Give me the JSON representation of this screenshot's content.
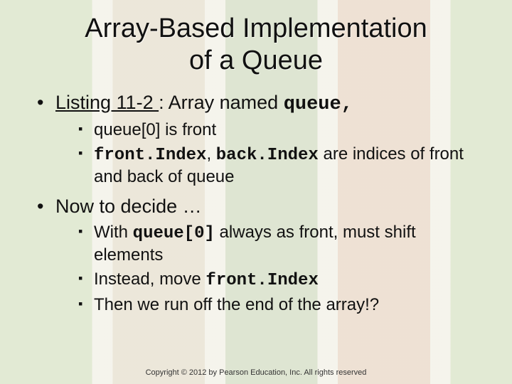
{
  "title_line1": "Array-Based Implementation",
  "title_line2": "of a Queue",
  "bullets": {
    "b1_pre": "",
    "b1_link": "Listing 11-2 ",
    "b1_mid": ": Array named ",
    "b1_code": "queue,",
    "b1a": "queue[0] is front",
    "b1b_code1": "front.Index",
    "b1b_mid1": ", ",
    "b1b_code2": "back.Index",
    "b1b_mid2": " are indices of front and back of queue",
    "b2": "Now to decide …",
    "b2a_pre": "With ",
    "b2a_code": "queue[0]",
    "b2a_post": "  always as front, must shift elements",
    "b2b_pre": "Instead, move ",
    "b2b_code": "front.Index",
    "b2c": "Then we run off the end of the array!?"
  },
  "footer": "Copyright © 2012 by Pearson Education, Inc. All rights reserved"
}
